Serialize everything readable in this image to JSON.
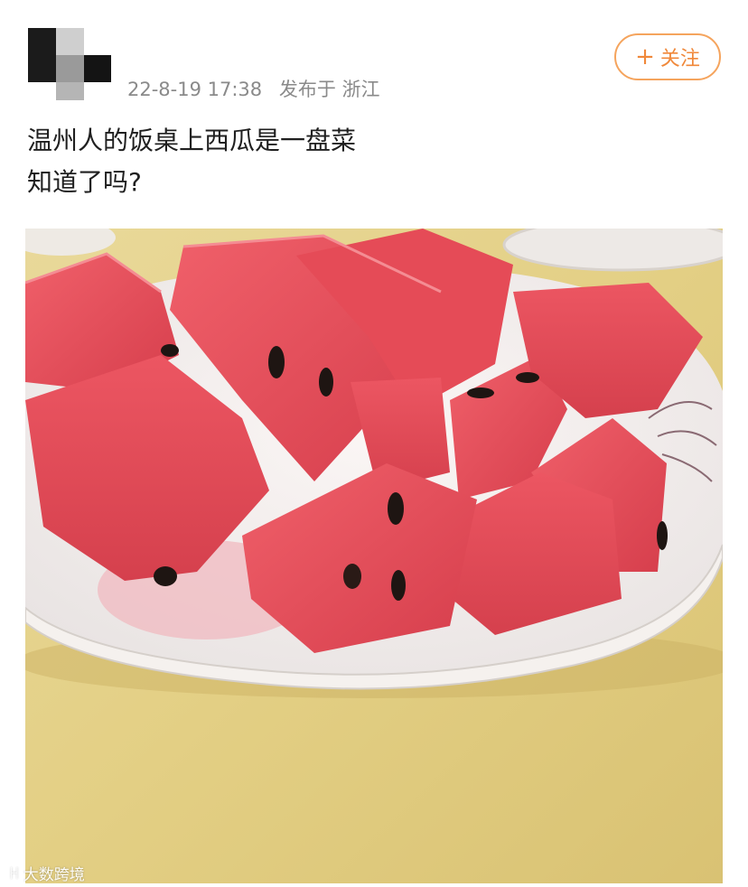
{
  "post": {
    "timestamp": "22-8-19 17:38",
    "location": "发布于 浙江",
    "follow_label": "关注",
    "follow_icon": "plus-icon",
    "text_line1": "温州人的饭桌上西瓜是一盘菜",
    "text_line2": "知道了吗?"
  },
  "image": {
    "subject": "plate-of-watermelon-chunks"
  },
  "watermark": {
    "logo_text": "ꀿ",
    "text": "大数跨境"
  },
  "colors": {
    "accent": "#f0883a",
    "meta_text": "#8a8a8a",
    "watermelon": "#e8505b",
    "table": "#e6d58e"
  }
}
